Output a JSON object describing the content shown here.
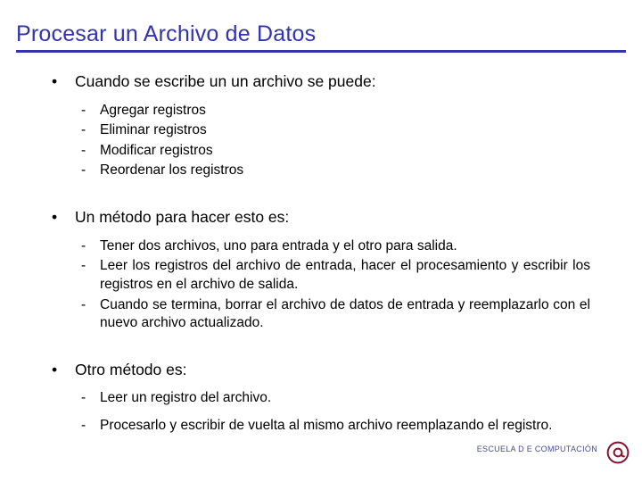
{
  "slide": {
    "title": "Procesar un Archivo de Datos",
    "accent_color": "#3333aa",
    "sections": [
      {
        "bullet_glyph": "•",
        "text": "Cuando se escribe un un archivo se puede:",
        "subitems": [
          {
            "dash_glyph": "-",
            "text": "Agregar registros"
          },
          {
            "dash_glyph": "-",
            "text": "Eliminar registros"
          },
          {
            "dash_glyph": "-",
            "text": "Modificar registros"
          },
          {
            "dash_glyph": "-",
            "text": "Reordenar los registros"
          }
        ]
      },
      {
        "bullet_glyph": "•",
        "text": "Un método para hacer esto es:",
        "subitems": [
          {
            "dash_glyph": "-",
            "text": "Tener dos archivos, uno para entrada y el otro para salida."
          },
          {
            "dash_glyph": "-",
            "text": "Leer los registros del archivo de entrada, hacer el procesamiento y escribir los registros en el archivo de salida."
          },
          {
            "dash_glyph": "-",
            "text": "Cuando se termina, borrar el archivo de datos de entrada y reemplazarlo con el nuevo archivo actualizado."
          }
        ]
      },
      {
        "bullet_glyph": "•",
        "text": "Otro método es:",
        "subitems": [
          {
            "dash_glyph": "-",
            "text": "Leer un registro del archivo."
          },
          {
            "dash_glyph": "-",
            "text": "Procesarlo y escribir de vuelta al mismo archivo reemplazando el registro."
          }
        ]
      }
    ],
    "footer": {
      "text": "ESCUELA D E COMPUTACIÓN",
      "logo_name": "at-sign-logo"
    }
  }
}
